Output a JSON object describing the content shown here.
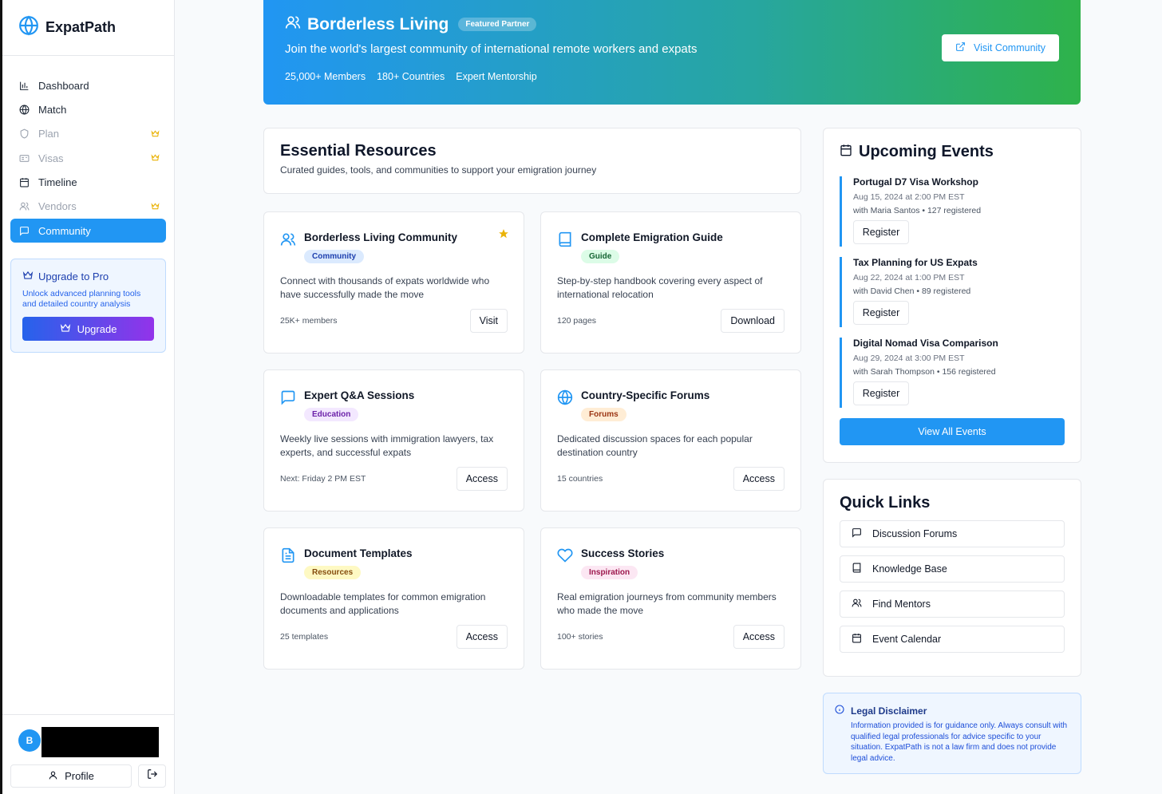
{
  "app": {
    "name": "ExpatPath"
  },
  "nav": {
    "items": [
      {
        "label": "Dashboard",
        "icon": "bar-chart-icon"
      },
      {
        "label": "Match",
        "icon": "globe-icon"
      },
      {
        "label": "Plan",
        "icon": "shield-icon",
        "locked": true
      },
      {
        "label": "Visas",
        "icon": "id-card-icon",
        "locked": true
      },
      {
        "label": "Timeline",
        "icon": "calendar-icon"
      },
      {
        "label": "Vendors",
        "icon": "users-icon",
        "locked": true
      },
      {
        "label": "Community",
        "icon": "message-icon",
        "active": true
      }
    ]
  },
  "upgrade": {
    "title": "Upgrade to Pro",
    "desc": "Unlock advanced planning tools and detailed country analysis",
    "button": "Upgrade"
  },
  "user": {
    "initial": "B",
    "profile": "Profile"
  },
  "hero": {
    "title": "Borderless Living",
    "badge": "Featured Partner",
    "subtitle": "Join the world's largest community of international remote workers and expats",
    "stats": [
      "25,000+ Members",
      "180+ Countries",
      "Expert Mentorship"
    ],
    "button": "Visit Community"
  },
  "essentials": {
    "title": "Essential Resources",
    "subtitle": "Curated guides, tools, and communities to support your emigration journey"
  },
  "resources": [
    {
      "title": "Borderless Living Community",
      "badge": "Community",
      "desc": "Connect with thousands of expats worldwide who have successfully made the move",
      "meta": "25K+ members",
      "button": "Visit",
      "featured": true
    },
    {
      "title": "Complete Emigration Guide",
      "badge": "Guide",
      "desc": "Step-by-step handbook covering every aspect of international relocation",
      "meta": "120 pages",
      "button": "Download"
    },
    {
      "title": "Expert Q&A Sessions",
      "badge": "Education",
      "desc": "Weekly live sessions with immigration lawyers, tax experts, and successful expats",
      "meta": "Next: Friday 2 PM EST",
      "button": "Access"
    },
    {
      "title": "Country-Specific Forums",
      "badge": "Forums",
      "desc": "Dedicated discussion spaces for each popular destination country",
      "meta": "15 countries",
      "button": "Access"
    },
    {
      "title": "Document Templates",
      "badge": "Resources",
      "desc": "Downloadable templates for common emigration documents and applications",
      "meta": "25 templates",
      "button": "Access"
    },
    {
      "title": "Success Stories",
      "badge": "Inspiration",
      "desc": "Real emigration journeys from community members who made the move",
      "meta": "100+ stories",
      "button": "Access"
    }
  ],
  "events": {
    "title": "Upcoming Events",
    "items": [
      {
        "title": "Portugal D7 Visa Workshop",
        "date": "Aug 15, 2024 at 2:00 PM EST",
        "host": "with Maria Santos • 127 registered",
        "button": "Register"
      },
      {
        "title": "Tax Planning for US Expats",
        "date": "Aug 22, 2024 at 1:00 PM EST",
        "host": "with David Chen • 89 registered",
        "button": "Register"
      },
      {
        "title": "Digital Nomad Visa Comparison",
        "date": "Aug 29, 2024 at 3:00 PM EST",
        "host": "with Sarah Thompson • 156 registered",
        "button": "Register"
      }
    ],
    "view_all": "View All Events"
  },
  "quick_links": {
    "title": "Quick Links",
    "items": [
      {
        "label": "Discussion Forums",
        "icon": "message-icon"
      },
      {
        "label": "Knowledge Base",
        "icon": "book-icon"
      },
      {
        "label": "Find Mentors",
        "icon": "users-icon"
      },
      {
        "label": "Event Calendar",
        "icon": "calendar-icon"
      }
    ]
  },
  "disclaimer": {
    "title": "Legal Disclaimer",
    "text": "Information provided is for guidance only. Always consult with qualified legal professionals for advice specific to your situation. ExpatPath is not a law firm and does not provide legal advice."
  },
  "colors": {
    "accent": "#2196f3",
    "crown": "#eab308"
  }
}
